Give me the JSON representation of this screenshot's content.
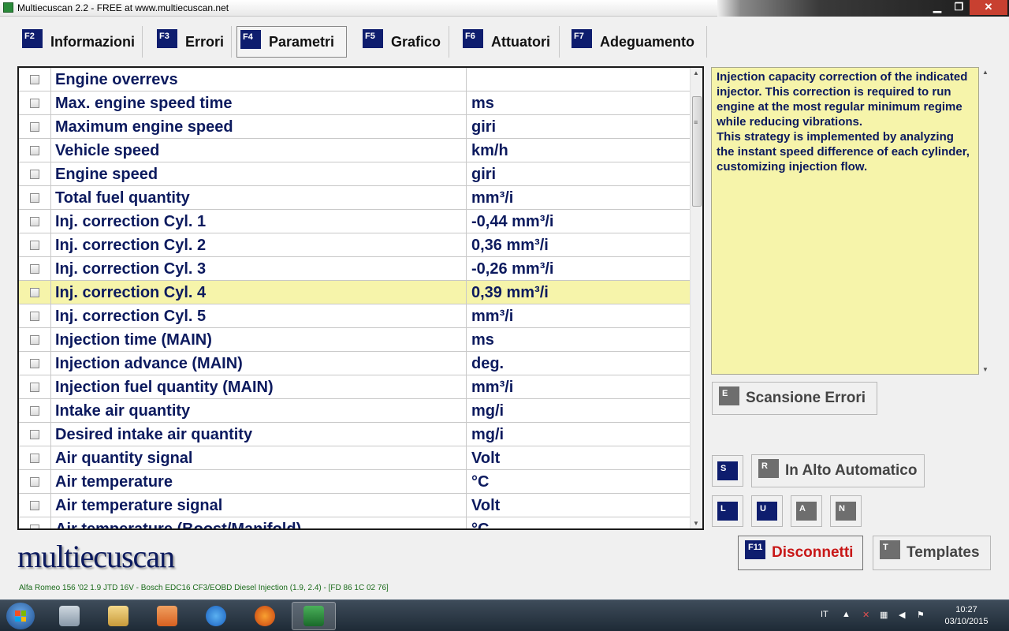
{
  "window": {
    "title": "Multiecuscan 2.2 - FREE at www.multiecuscan.net",
    "min": "▁",
    "max": "❐",
    "close": "✕"
  },
  "tabs": [
    {
      "key": "F2",
      "label": "Informazioni"
    },
    {
      "key": "F3",
      "label": "Errori"
    },
    {
      "key": "F4",
      "label": "Parametri"
    },
    {
      "key": "F5",
      "label": "Grafico"
    },
    {
      "key": "F6",
      "label": "Attuatori"
    },
    {
      "key": "F7",
      "label": "Adeguamento"
    }
  ],
  "active_tab": "Parametri",
  "parameters": [
    {
      "name": "Engine overrevs",
      "value": ""
    },
    {
      "name": "Max. engine speed time",
      "value": " ms"
    },
    {
      "name": "Maximum engine speed",
      "value": " giri"
    },
    {
      "name": "Vehicle speed",
      "value": " km/h"
    },
    {
      "name": "Engine speed",
      "value": " giri"
    },
    {
      "name": "Total fuel quantity",
      "value": " mm³/i"
    },
    {
      "name": "Inj. correction Cyl. 1",
      "value": "-0,44 mm³/i"
    },
    {
      "name": "Inj. correction Cyl. 2",
      "value": "0,36 mm³/i"
    },
    {
      "name": "Inj. correction Cyl. 3",
      "value": "-0,26 mm³/i"
    },
    {
      "name": "Inj. correction Cyl. 4",
      "value": "0,39 mm³/i"
    },
    {
      "name": "Inj. correction Cyl. 5",
      "value": " mm³/i"
    },
    {
      "name": "Injection time (MAIN)",
      "value": " ms"
    },
    {
      "name": "Injection advance (MAIN)",
      "value": " deg."
    },
    {
      "name": "Injection fuel quantity (MAIN)",
      "value": " mm³/i"
    },
    {
      "name": "Intake air quantity",
      "value": " mg/i"
    },
    {
      "name": "Desired intake air quantity",
      "value": " mg/i"
    },
    {
      "name": "Air quantity signal",
      "value": " Volt"
    },
    {
      "name": "Air temperature",
      "value": " °C"
    },
    {
      "name": "Air temperature signal",
      "value": " Volt"
    },
    {
      "name": "Air temperature (Boost/Manifold)",
      "value": " °C"
    }
  ],
  "selected_row": "Inj. correction Cyl. 4",
  "description": {
    "para1": "Injection capacity correction of the indicated injector. This correction is required to run engine at the most regular minimum regime while reducing vibrations.",
    "para2": "This strategy is implemented by analyzing the instant speed difference of each cylinder, customizing injection flow."
  },
  "buttons": {
    "scan_errors": {
      "key": "E",
      "label": "Scansione Errori"
    },
    "s_key": "S",
    "auto_top": {
      "key": "R",
      "label": "In Alto Automatico"
    },
    "l_key": "L",
    "u_key": "U",
    "a_key": "A",
    "n_key": "N",
    "disconnect": {
      "key": "F11",
      "label": "Disconnetti"
    },
    "templates": {
      "key": "T",
      "label": "Templates"
    }
  },
  "logo": "multiecuscan",
  "status_line": "Alfa Romeo 156 '02 1.9 JTD 16V - Bosch EDC16 CF3/EOBD Diesel Injection (1.9, 2.4) - [FD 86 1C 02 76]",
  "taskbar": {
    "lang": "IT",
    "time": "10:27",
    "date": "03/10/2015"
  },
  "colors": {
    "navy": "#0e1d6e",
    "highlight": "#f6f4aa",
    "disconnect_red": "#c81818"
  }
}
